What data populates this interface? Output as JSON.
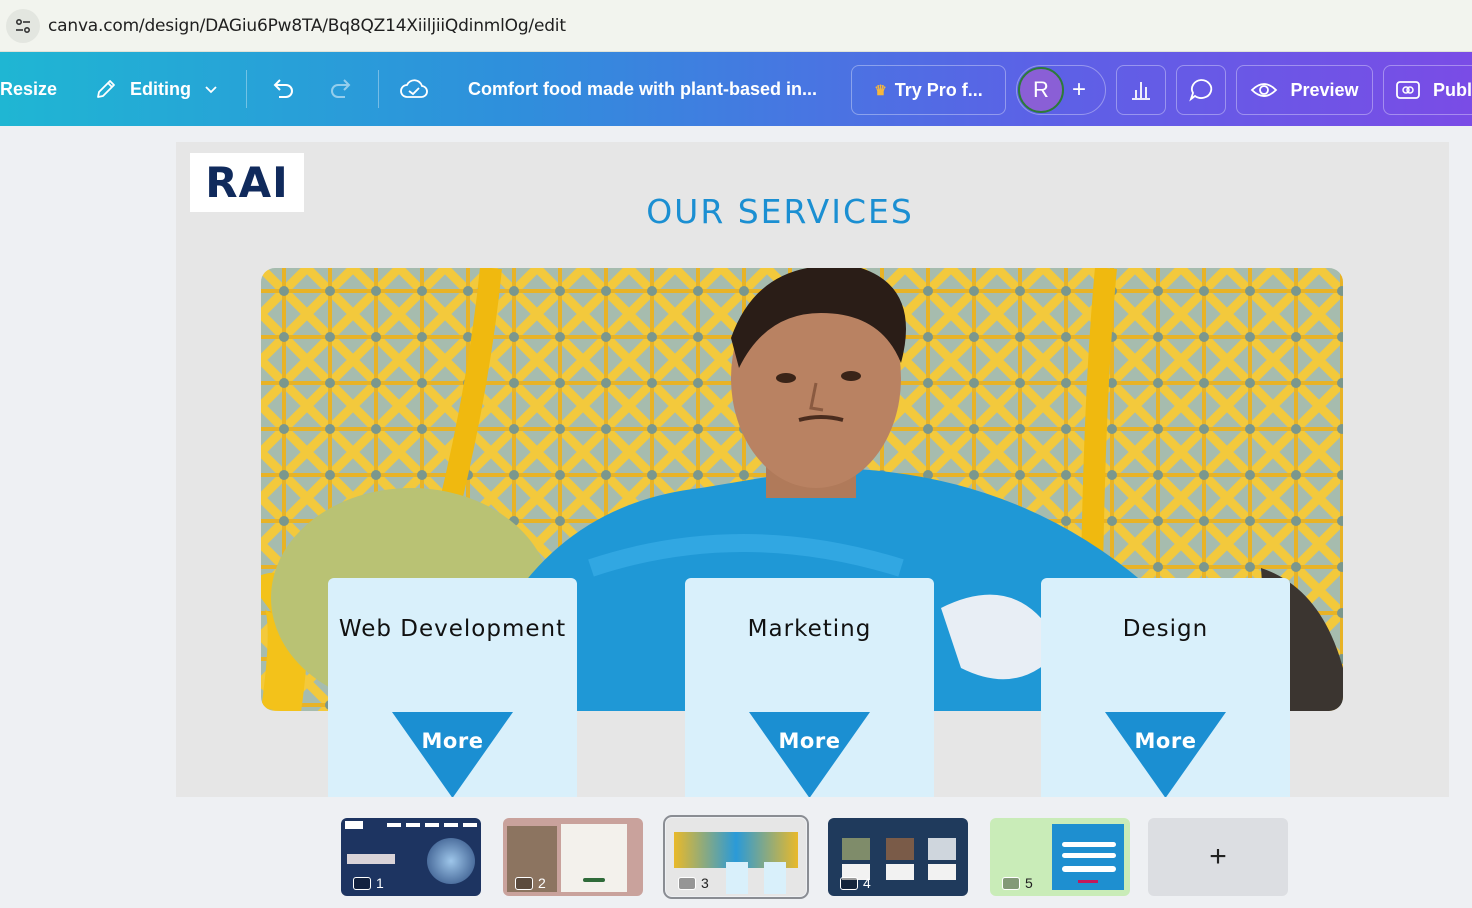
{
  "browser": {
    "url": "canva.com/design/DAGiu6Pw8TA/Bq8QZ14XiiljiiQdinmlOg/edit"
  },
  "toolbar": {
    "resize_label": "Resize",
    "editing_label": "Editing",
    "doc_title": "Comfort food made with plant-based in...",
    "try_pro_label": "Try Pro f...",
    "avatar_initial": "R",
    "preview_label": "Preview",
    "publish_label": "Publ"
  },
  "slide": {
    "logo_text": "RAI",
    "title": "OUR SERVICES",
    "cards": [
      {
        "title": "Web Development",
        "button": "More"
      },
      {
        "title": "Marketing",
        "button": "More"
      },
      {
        "title": "Design",
        "button": "More"
      }
    ]
  },
  "pages": [
    {
      "number": "1",
      "selected": false
    },
    {
      "number": "2",
      "selected": false
    },
    {
      "number": "3",
      "selected": true
    },
    {
      "number": "4",
      "selected": false
    },
    {
      "number": "5",
      "selected": false
    }
  ],
  "add_page_symbol": "+",
  "colors": {
    "accent": "#1b8fd2",
    "card_bg": "#d9f0fb",
    "triangle": "#1b8fd2",
    "logo": "#102a5c"
  }
}
